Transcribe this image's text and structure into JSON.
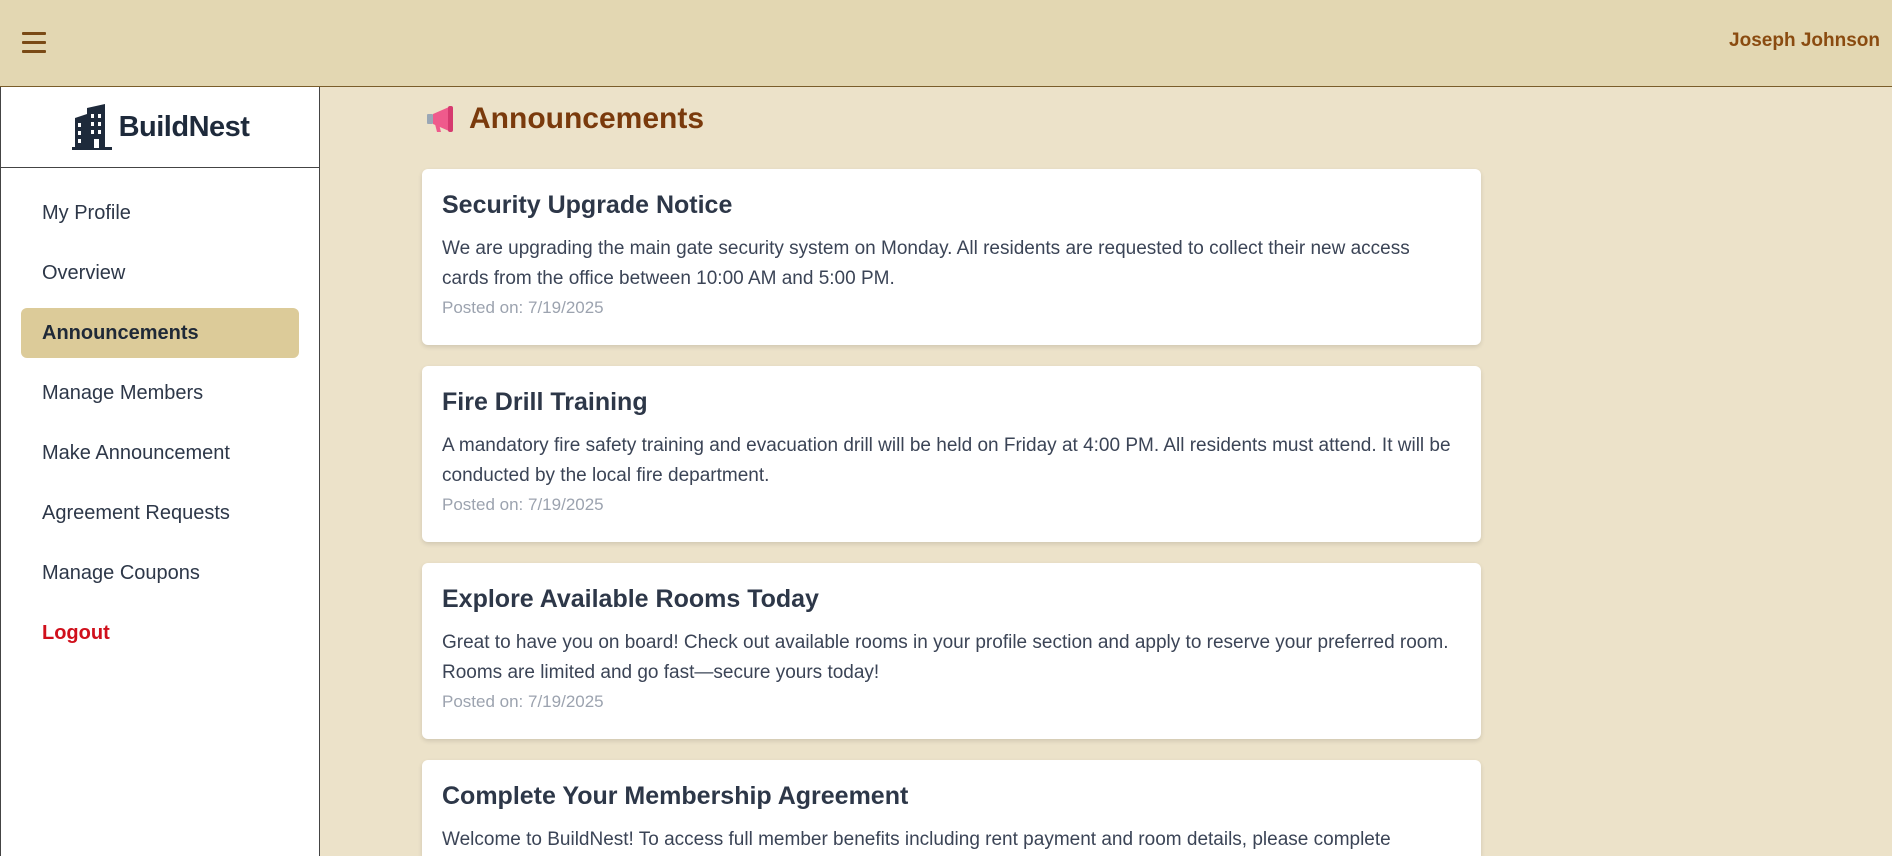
{
  "header": {
    "menu_icon": "hamburger-menu-icon",
    "user_name": "Joseph Johnson"
  },
  "brand": {
    "icon": "building-icon",
    "name": "BuildNest"
  },
  "sidebar": {
    "items": [
      {
        "label": "My Profile",
        "active": false
      },
      {
        "label": "Overview",
        "active": false
      },
      {
        "label": "Announcements",
        "active": true
      },
      {
        "label": "Manage Members",
        "active": false
      },
      {
        "label": "Make Announcement",
        "active": false
      },
      {
        "label": "Agreement Requests",
        "active": false
      },
      {
        "label": "Manage Coupons",
        "active": false
      }
    ],
    "logout_label": "Logout"
  },
  "page": {
    "icon": "megaphone-icon",
    "title": "Announcements"
  },
  "announcements": [
    {
      "title": "Security Upgrade Notice",
      "body": "We are upgrading the main gate security system on Monday. All residents are requested to collect their new access cards from the office between 10:00 AM and 5:00 PM.",
      "date": "Posted on: 7/19/2025"
    },
    {
      "title": "Fire Drill Training",
      "body": "A mandatory fire safety training and evacuation drill will be held on Friday at 4:00 PM. All residents must attend. It will be conducted by the local fire department.",
      "date": "Posted on: 7/19/2025"
    },
    {
      "title": "Explore Available Rooms Today",
      "body": "Great to have you on board! Check out available rooms in your profile section and apply to reserve your preferred room. Rooms are limited and go fast—secure yours today!",
      "date": "Posted on: 7/19/2025"
    },
    {
      "title": "Complete Your Membership Agreement",
      "body": "Welcome to BuildNest! To access full member benefits including rent payment and room details, please complete",
      "date": ""
    }
  ],
  "colors": {
    "topbar": "#e3d7b2",
    "background": "#ece2c9",
    "active_nav": "#dccb99",
    "accent_text": "#7a3a0c",
    "logout": "#d0101c"
  }
}
